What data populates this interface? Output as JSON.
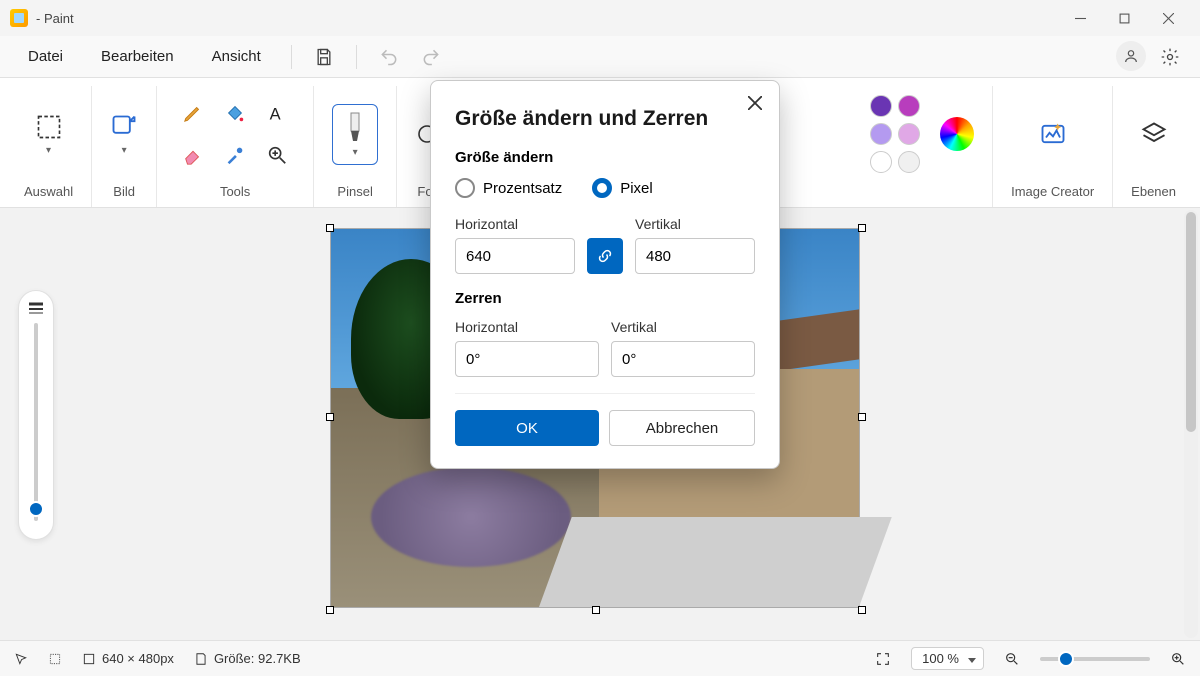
{
  "titlebar": {
    "suffix": " - Paint"
  },
  "menu": {
    "file": "Datei",
    "edit": "Bearbeiten",
    "view": "Ansicht"
  },
  "ribbon": {
    "select": "Auswahl",
    "image": "Bild",
    "tools": "Tools",
    "brushes": "Pinsel",
    "shapes_partial": "For",
    "image_creator": "Image Creator",
    "layers": "Ebenen"
  },
  "dialog": {
    "title": "Größe ändern und Zerren",
    "resize_section": "Größe ändern",
    "percent_label": "Prozentsatz",
    "pixel_label": "Pixel",
    "horizontal": "Horizontal",
    "vertical": "Vertikal",
    "h_value": "640",
    "v_value": "480",
    "skew_section": "Zerren",
    "skew_h": "0°",
    "skew_v": "0°",
    "ok": "OK",
    "cancel": "Abbrechen"
  },
  "status": {
    "dimensions": "640 × 480px",
    "size_label": "Größe: 92.7KB",
    "zoom": "100 %"
  },
  "colors": {
    "swatch1": "#6a35b3",
    "swatch2": "#b83dbd",
    "swatch3": "#b49af0",
    "swatch4": "#e0a8e6",
    "swatch5": "#ffffff",
    "swatch6": "#f0f0f0"
  }
}
